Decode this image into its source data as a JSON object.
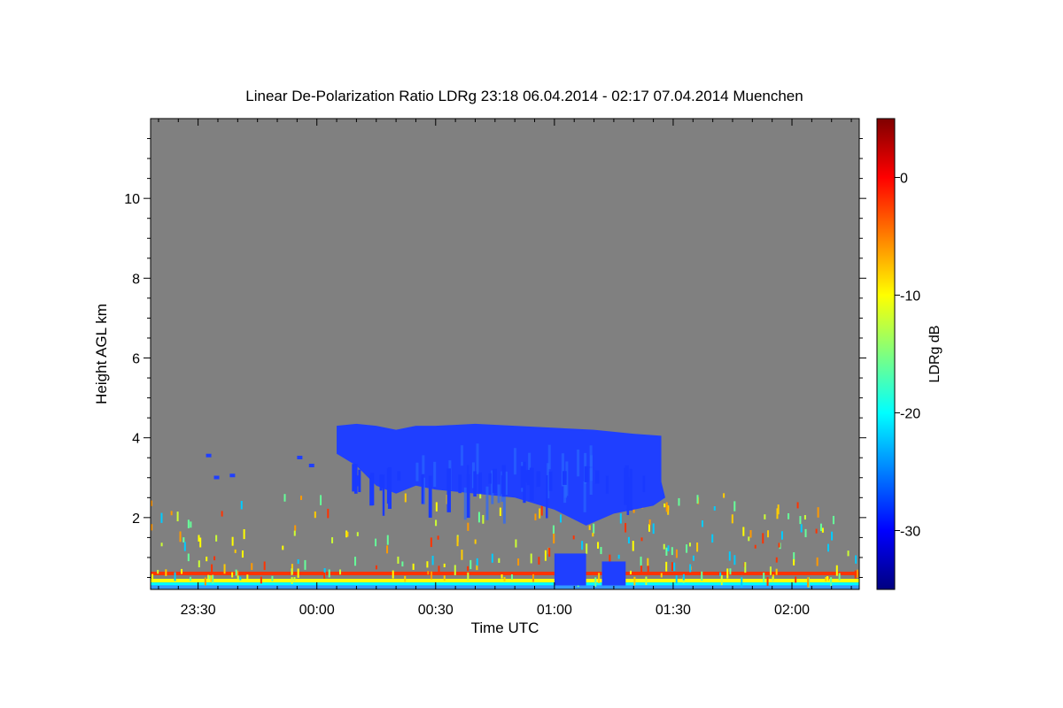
{
  "chart_data": {
    "type": "heatmap",
    "title": "Linear De-Polarization Ratio LDRg   23:18 06.04.2014 - 02:17 07.04.2014 Muenchen",
    "xlabel": "Time UTC",
    "ylabel": "Height AGL km",
    "x_range_minutes": [
      -42,
      137
    ],
    "x_tick_values_minutes": [
      -30,
      0,
      30,
      60,
      90,
      120
    ],
    "x_tick_labels": [
      "23:30",
      "00:00",
      "00:30",
      "01:00",
      "01:30",
      "02:00"
    ],
    "ylim": [
      0.2,
      12.0
    ],
    "y_ticks": [
      2,
      4,
      6,
      8,
      10
    ],
    "y_tick_labels": [
      "2",
      "4",
      "6",
      "8",
      "10"
    ],
    "background_color": "#808080",
    "colorbar": {
      "label": "LDRg dB",
      "range": [
        -35,
        5
      ],
      "ticks": [
        0,
        -10,
        -20,
        -30
      ],
      "tick_labels": [
        "0",
        "-10",
        "-20",
        "-30"
      ],
      "colormap": [
        "#00007f",
        "#0000ff",
        "#007fff",
        "#00ffff",
        "#7fff7f",
        "#ffff00",
        "#ff7f00",
        "#ff0000",
        "#7f0000"
      ]
    },
    "cloud_layer": {
      "description_value_dB": -31,
      "top_profile": [
        {
          "t": 5,
          "h": 4.3
        },
        {
          "t": 10,
          "h": 4.35
        },
        {
          "t": 15,
          "h": 4.3
        },
        {
          "t": 20,
          "h": 4.2
        },
        {
          "t": 25,
          "h": 4.3
        },
        {
          "t": 30,
          "h": 4.3
        },
        {
          "t": 40,
          "h": 4.35
        },
        {
          "t": 50,
          "h": 4.3
        },
        {
          "t": 60,
          "h": 4.25
        },
        {
          "t": 70,
          "h": 4.2
        },
        {
          "t": 80,
          "h": 4.1
        },
        {
          "t": 87,
          "h": 4.05
        }
      ],
      "base_profile": [
        {
          "t": 87,
          "h": 2.9
        },
        {
          "t": 88,
          "h": 2.5
        },
        {
          "t": 85,
          "h": 2.3
        },
        {
          "t": 80,
          "h": 2.2
        },
        {
          "t": 75,
          "h": 2.1
        },
        {
          "t": 68,
          "h": 1.8
        },
        {
          "t": 64,
          "h": 2.0
        },
        {
          "t": 60,
          "h": 2.2
        },
        {
          "t": 50,
          "h": 2.5
        },
        {
          "t": 40,
          "h": 2.6
        },
        {
          "t": 30,
          "h": 2.7
        },
        {
          "t": 25,
          "h": 2.8
        },
        {
          "t": 20,
          "h": 2.6
        },
        {
          "t": 15,
          "h": 2.8
        },
        {
          "t": 10,
          "h": 3.3
        },
        {
          "t": 5,
          "h": 3.6
        }
      ],
      "small_patches": [
        {
          "t": -28,
          "h": 3.6
        },
        {
          "t": -26,
          "h": 3.05
        },
        {
          "t": -22,
          "h": 3.1
        },
        {
          "t": -5,
          "h": 3.55
        },
        {
          "t": -2,
          "h": 3.35
        }
      ],
      "low_patches": [
        {
          "t": 60,
          "t2": 68,
          "h1": 0.3,
          "h2": 1.1
        },
        {
          "t": 72,
          "t2": 78,
          "h1": 0.3,
          "h2": 0.9
        }
      ]
    },
    "near_ground_layers": [
      {
        "h": 0.6,
        "value_dB": 0,
        "color": "#ff3300"
      },
      {
        "h": 0.42,
        "value_dB": -8,
        "color": "#ffff00"
      },
      {
        "h": 0.33,
        "value_dB": -18,
        "color": "#00ffff"
      },
      {
        "h": 0.26,
        "value_dB": -24,
        "color": "#3399ff"
      }
    ]
  }
}
